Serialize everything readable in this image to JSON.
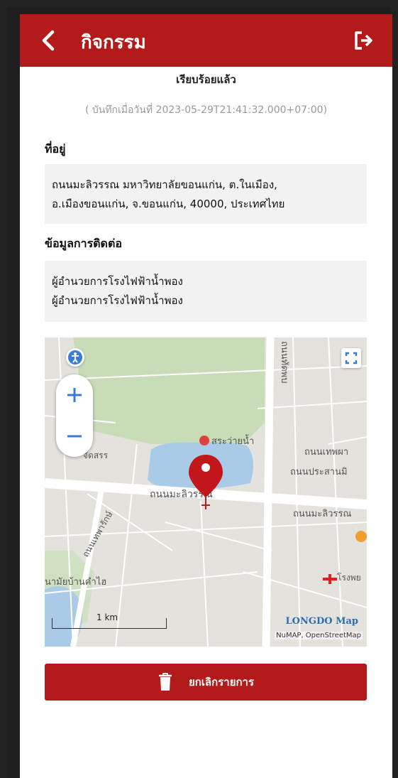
{
  "header": {
    "title": "กิจกรรม"
  },
  "status": "เรียบร้อยแล้ว",
  "saved_text": "( บันทึกเมื่อวันที่ 2023-05-29T21:41:32.000+07:00)",
  "address": {
    "heading": "ที่อยู่",
    "line1": "ถนนมะลิวรรณ มหาวิทยาลัยขอนแก่น, ต.ในเมือง,",
    "line2": "อ.เมืองขอนแก่น, จ.ขอนแก่น, 40000, ประเทศไทย"
  },
  "contact": {
    "heading": "ข้อมูลการติดต่อ",
    "line1": "ผู้อำนวยการโรงไฟฟ้าน้ำพอง",
    "line2": "ผู้อำนวยการโรงไฟฟ้าน้ำพอง"
  },
  "map": {
    "labels": {
      "road1": "ถนนมะลิวรรณ",
      "road2": "ถนนมะลิวรรณ",
      "road3": "ถนนเทพผา",
      "road4": "ถนนประสานมิ",
      "road5": "ถนนทัดพบ",
      "poi1": "สระว่ายน้ำ",
      "poi2": "จัดสรร",
      "poi3": "นามัยบ้านคำไฮ",
      "poi4": "โรงพย",
      "poi5": "ถนนเทพารักษ์"
    },
    "scale": "1 km",
    "brand": "LONGDO Map",
    "attribution": "NuMAP, OpenStreetMap"
  },
  "cancel_button": "ยกเลิกรายการ",
  "colors": {
    "primary": "#b31b1b",
    "box_bg": "#f2f2f2"
  },
  "icons": {
    "back": "chevron-left-icon",
    "logout": "logout-icon",
    "trash": "trash-icon",
    "pin": "map-pin-icon"
  }
}
